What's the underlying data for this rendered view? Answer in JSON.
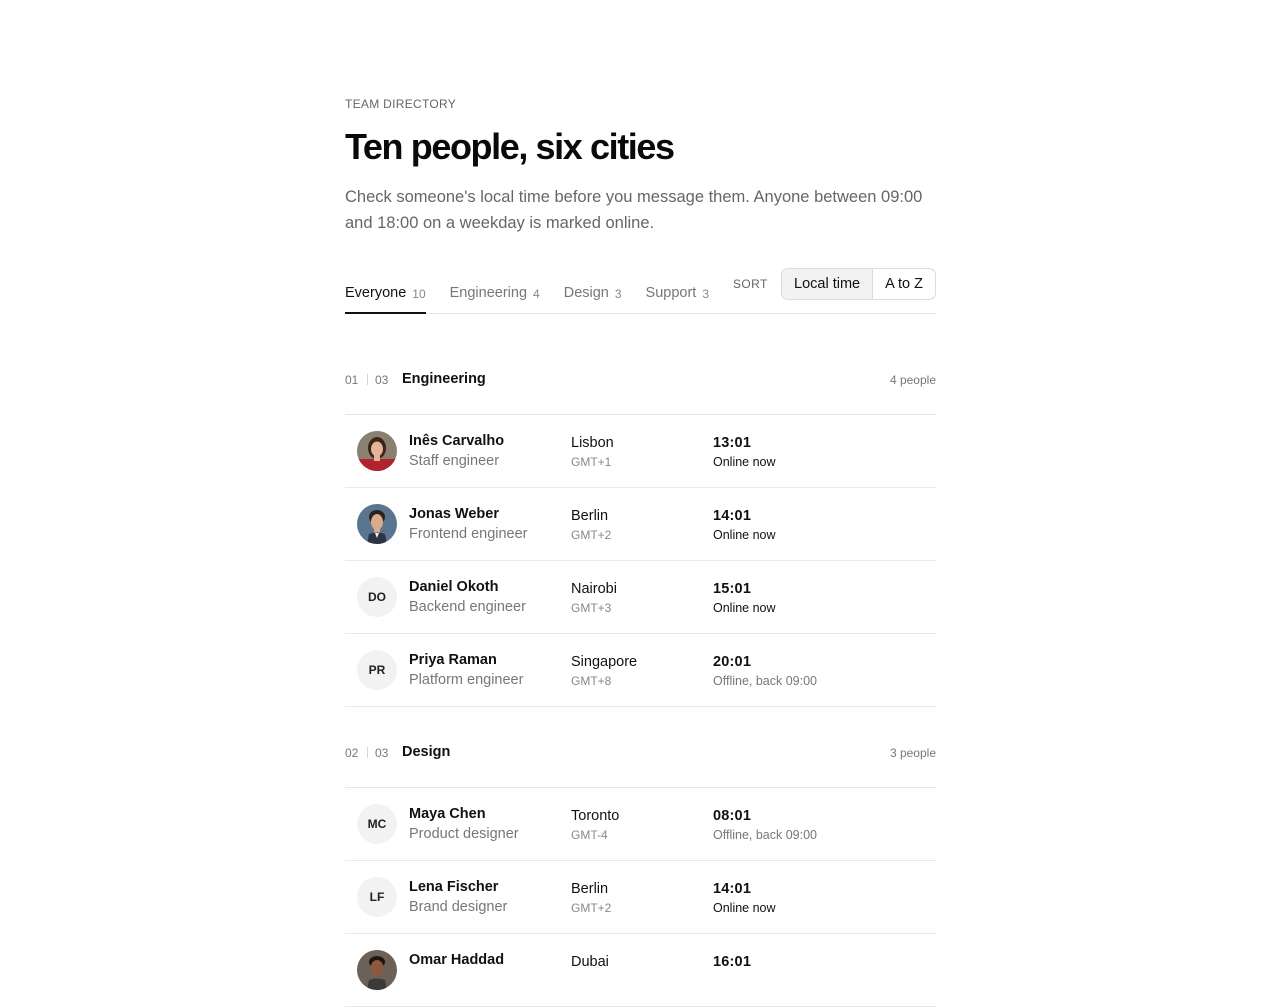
{
  "header": {
    "eyebrow": "TEAM DIRECTORY",
    "title": "Ten people, six cities",
    "lede": "Check someone's local time before you message them. Anyone between 09:00 and 18:00 on a weekday is marked online."
  },
  "tabs": [
    {
      "label": "Everyone",
      "count": "10"
    },
    {
      "label": "Engineering",
      "count": "4"
    },
    {
      "label": "Design",
      "count": "3"
    },
    {
      "label": "Support",
      "count": "3"
    }
  ],
  "sort": {
    "label": "SORT",
    "options": [
      "Local time",
      "A to Z"
    ]
  },
  "groups": [
    {
      "index": "01",
      "total": "03",
      "name": "Engineering",
      "count": "4 people",
      "people": [
        {
          "initials": "",
          "photo": "photo-avatar-red",
          "name": "Inês Carvalho",
          "role": "Staff engineer",
          "city": "Lisbon",
          "tz": "GMT+1",
          "time": "13:01",
          "status": "Online now"
        },
        {
          "initials": "",
          "photo": "photo-avatar-blue",
          "name": "Jonas Weber",
          "role": "Frontend engineer",
          "city": "Berlin",
          "tz": "GMT+2",
          "time": "14:01",
          "status": "Online now"
        },
        {
          "initials": "DO",
          "name": "Daniel Okoth",
          "role": "Backend engineer",
          "city": "Nairobi",
          "tz": "GMT+3",
          "time": "15:01",
          "status": "Online now"
        },
        {
          "initials": "PR",
          "name": "Priya Raman",
          "role": "Platform engineer",
          "city": "Singapore",
          "tz": "GMT+8",
          "time": "20:01",
          "status": "Offline, back 09:00"
        }
      ]
    },
    {
      "index": "02",
      "total": "03",
      "name": "Design",
      "count": "3 people",
      "people": [
        {
          "initials": "MC",
          "name": "Maya Chen",
          "role": "Product designer",
          "city": "Toronto",
          "tz": "GMT-4",
          "time": "08:01",
          "status": "Offline, back 09:00"
        },
        {
          "initials": "LF",
          "name": "Lena Fischer",
          "role": "Brand designer",
          "city": "Berlin",
          "tz": "GMT+2",
          "time": "14:01",
          "status": "Online now"
        },
        {
          "initials": "",
          "photo": "photo-avatar-dark",
          "name": "Omar Haddad",
          "role": "",
          "city": "Dubai",
          "tz": "",
          "time": "16:01",
          "status": ""
        }
      ]
    }
  ]
}
